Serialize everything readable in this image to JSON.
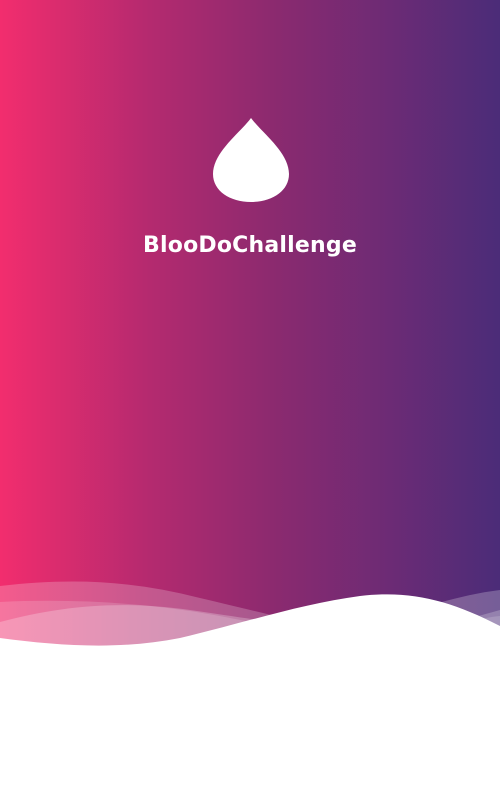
{
  "splash": {
    "title": "BlooDoChallenge",
    "logo_icon": "blood-drop-icon",
    "gradient_colors": [
      "#f22d6e",
      "#8b2a6f",
      "#4b2c78"
    ],
    "wave_color": "#ffffff"
  }
}
